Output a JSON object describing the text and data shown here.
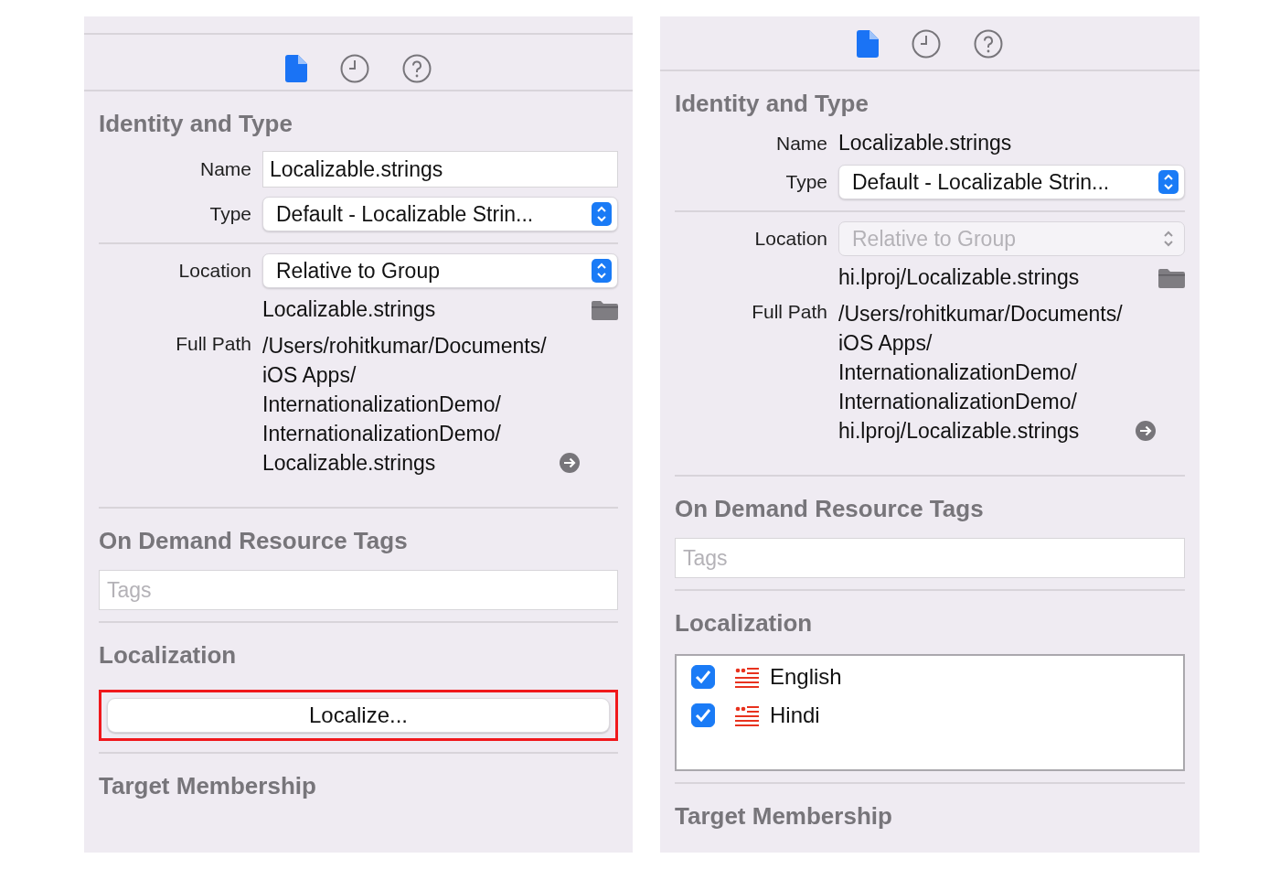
{
  "panels": [
    {
      "tabs": [
        {
          "kind": "file",
          "selected": true
        },
        {
          "kind": "history",
          "selected": false
        },
        {
          "kind": "help",
          "selected": false
        }
      ],
      "identity": {
        "title": "Identity and Type",
        "name_label": "Name",
        "name_value": "Localizable.strings",
        "name_editable": true,
        "type_label": "Type",
        "type_value": "Default - Localizable Strin...",
        "location_label": "Location",
        "location_value": "Relative to Group",
        "location_disabled": false,
        "location_path": "Localizable.strings",
        "full_path_label": "Full Path",
        "full_path": "/Users/rohitkumar/Documents/iOS Apps/InternationalizationDemo/InternationalizationDemo/Localizable.strings"
      },
      "tags": {
        "title": "On Demand Resource Tags",
        "placeholder": "Tags"
      },
      "localization": {
        "title": "Localization",
        "kind": "button",
        "button_label": "Localize...",
        "highlighted": true
      },
      "target": {
        "title": "Target Membership"
      }
    },
    {
      "tabs": [
        {
          "kind": "file",
          "selected": true
        },
        {
          "kind": "history",
          "selected": false
        },
        {
          "kind": "help",
          "selected": false
        }
      ],
      "identity": {
        "title": "Identity and Type",
        "name_label": "Name",
        "name_value": "Localizable.strings",
        "name_editable": false,
        "type_label": "Type",
        "type_value": "Default - Localizable Strin...",
        "location_label": "Location",
        "location_value": "Relative to Group",
        "location_disabled": true,
        "location_path": "hi.lproj/Localizable.strings",
        "full_path_label": "Full Path",
        "full_path": "/Users/rohitkumar/Documents/iOS Apps/InternationalizationDemo/InternationalizationDemo/hi.lproj/Localizable.strings"
      },
      "tags": {
        "title": "On Demand Resource Tags",
        "placeholder": "Tags"
      },
      "localization": {
        "title": "Localization",
        "kind": "list",
        "languages": [
          {
            "name": "English",
            "checked": true
          },
          {
            "name": "Hindi",
            "checked": true
          }
        ]
      },
      "target": {
        "title": "Target Membership"
      }
    }
  ]
}
